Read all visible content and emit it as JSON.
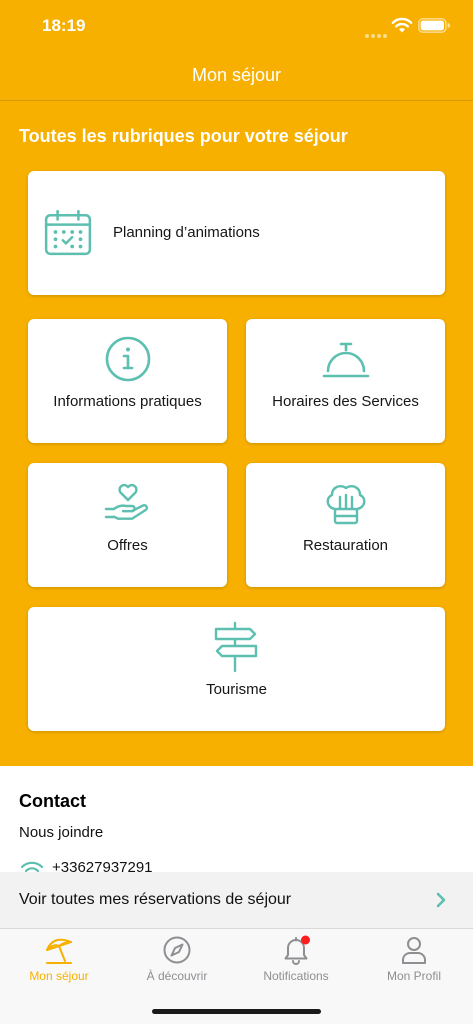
{
  "status_bar": {
    "time": "18:19",
    "icons": [
      "signal-icon",
      "wifi-icon",
      "battery-icon"
    ]
  },
  "header": {
    "title": "Mon séjour"
  },
  "main": {
    "section_title": "Toutes les rubriques pour votre séjour",
    "tiles": [
      {
        "label": "Planning d’animations",
        "icon": "calendar-icon"
      },
      {
        "label": "Informations pratiques",
        "icon": "info-icon"
      },
      {
        "label": "Horaires des Services",
        "icon": "service-bell-icon"
      },
      {
        "label": "Offres",
        "icon": "heart-hand-icon"
      },
      {
        "label": "Restauration",
        "icon": "chef-hat-icon"
      },
      {
        "label": "Tourisme",
        "icon": "signpost-icon"
      }
    ]
  },
  "contact": {
    "title": "Contact",
    "subtitle": "Nous joindre",
    "phone": "+33627937291",
    "phone_icon": "phone-icon"
  },
  "reservations_banner": {
    "label": "Voir toutes mes réservations de séjour",
    "icon": "chevron-right-icon"
  },
  "tab_bar": {
    "items": [
      {
        "label": "Mon séjour",
        "icon": "beach-umbrella-icon",
        "active": true
      },
      {
        "label": "À découvrir",
        "icon": "compass-icon",
        "active": false
      },
      {
        "label": "Notifications",
        "icon": "bell-icon",
        "active": false,
        "has_badge": true
      },
      {
        "label": "Mon Profil",
        "icon": "user-icon",
        "active": false
      }
    ]
  },
  "colors": {
    "primary": "#F7B000",
    "accent": "#5CBFAF",
    "badge": "#FF1E1E",
    "inactive": "#8E8E93"
  }
}
